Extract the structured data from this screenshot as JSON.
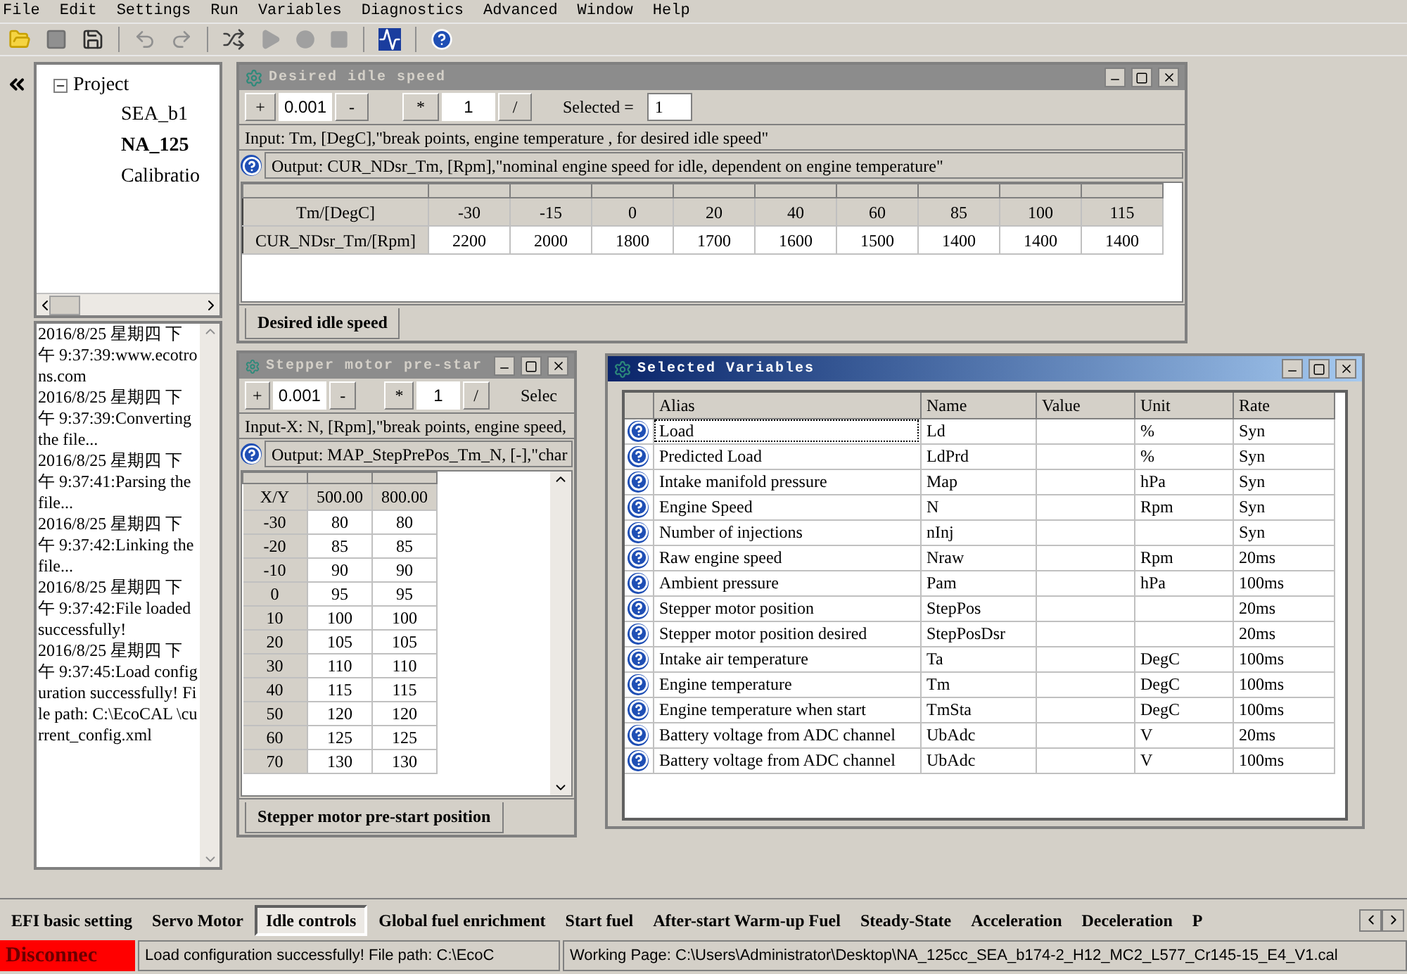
{
  "menu": [
    "File",
    "Edit",
    "Settings",
    "Run",
    "Variables",
    "Diagnostics",
    "Advanced",
    "Window",
    "Help"
  ],
  "tree": {
    "label": "Project",
    "expanded": true,
    "children": [
      {
        "label": "SEA_b1",
        "selected": false
      },
      {
        "label": "NA_125",
        "selected": true
      },
      {
        "label": "Calibratio",
        "selected": false
      }
    ]
  },
  "log": [
    "2016/8/25 星期四 下午 9:37:39:www.ecotrons.com",
    "2016/8/25 星期四 下午 9:37:39:Converting the file...",
    "2016/8/25 星期四 下午 9:37:41:Parsing the file...",
    "2016/8/25 星期四 下午 9:37:42:Linking the file...",
    "2016/8/25 星期四 下午 9:37:42:File loaded successfully!",
    "2016/8/25 星期四 下午 9:37:45:Load configuration successfully! File path: C:\\EcoCAL \\current_config.xml"
  ],
  "idle_window": {
    "title": "Desired idle speed",
    "active": false,
    "toolbar": {
      "add": "+",
      "step": "0.001",
      "sub": "-",
      "mul": "*",
      "factor": "1",
      "div": "/",
      "selected_label": "Selected =",
      "selected_value": "1"
    },
    "input": "Input: Tm, [DegC],\"break points, engine temperature , for desired idle speed\"",
    "output": "Output: CUR_NDsr_Tm, [Rpm],\"nominal engine speed for idle, dependent on engine temperature\"",
    "rows": [
      [
        "Tm/[DegC]",
        "-30",
        "-15",
        "0",
        "20",
        "40",
        "60",
        "85",
        "100",
        "115"
      ],
      [
        "CUR_NDsr_Tm/[Rpm]",
        "2200",
        "2000",
        "1800",
        "1700",
        "1600",
        "1500",
        "1400",
        "1400",
        "1400"
      ]
    ],
    "tab": "Desired idle speed"
  },
  "stepper_window": {
    "title": "Stepper motor pre-star",
    "active": false,
    "toolbar": {
      "add": "+",
      "step": "0.001",
      "sub": "-",
      "mul": "*",
      "factor": "1",
      "div": "/",
      "selected_label": "Selec"
    },
    "input": "Input-X: N, [Rpm],\"break points, engine speed,",
    "output": "Output: MAP_StepPrePos_Tm_N, [-],\"char",
    "header": [
      "X/Y",
      "500.00",
      "800.00"
    ],
    "rows": [
      [
        "-30",
        "80",
        "80"
      ],
      [
        "-20",
        "85",
        "85"
      ],
      [
        "-10",
        "90",
        "90"
      ],
      [
        "0",
        "95",
        "95"
      ],
      [
        "10",
        "100",
        "100"
      ],
      [
        "20",
        "105",
        "105"
      ],
      [
        "30",
        "110",
        "110"
      ],
      [
        "40",
        "115",
        "115"
      ],
      [
        "50",
        "120",
        "120"
      ],
      [
        "60",
        "125",
        "125"
      ],
      [
        "70",
        "130",
        "130"
      ]
    ],
    "tab": "Stepper motor pre-start position"
  },
  "variables_window": {
    "title": "Selected Variables",
    "active": true,
    "columns": [
      "Alias",
      "Name",
      "Value",
      "Unit",
      "Rate"
    ],
    "rows": [
      {
        "alias": "Load",
        "name": "Ld",
        "unit": "%",
        "rate": "Syn",
        "selected": true
      },
      {
        "alias": "Predicted Load",
        "name": "LdPrd",
        "unit": "%",
        "rate": "Syn",
        "selected": false
      },
      {
        "alias": "Intake manifold pressure",
        "name": "Map",
        "unit": "hPa",
        "rate": "Syn",
        "selected": false
      },
      {
        "alias": "Engine Speed",
        "name": "N",
        "unit": "Rpm",
        "rate": "Syn",
        "selected": false
      },
      {
        "alias": "Number of injections",
        "name": "nInj",
        "unit": "",
        "rate": "Syn",
        "selected": false
      },
      {
        "alias": "Raw engine speed",
        "name": "Nraw",
        "unit": "Rpm",
        "rate": "20ms",
        "selected": false
      },
      {
        "alias": "Ambient pressure",
        "name": "Pam",
        "unit": "hPa",
        "rate": "100ms",
        "selected": false
      },
      {
        "alias": "Stepper motor position",
        "name": "StepPos",
        "unit": "",
        "rate": "20ms",
        "selected": false
      },
      {
        "alias": "Stepper motor position desired",
        "name": "StepPosDsr",
        "unit": "",
        "rate": "20ms",
        "selected": false
      },
      {
        "alias": "Intake air temperature",
        "name": "Ta",
        "unit": "DegC",
        "rate": "100ms",
        "selected": false
      },
      {
        "alias": "Engine temperature",
        "name": "Tm",
        "unit": "DegC",
        "rate": "100ms",
        "selected": false
      },
      {
        "alias": "Engine temperature when start",
        "name": "TmSta",
        "unit": "DegC",
        "rate": "100ms",
        "selected": false
      },
      {
        "alias": "Battery voltage from ADC channel",
        "name": "UbAdc",
        "unit": "V",
        "rate": "20ms",
        "selected": false
      },
      {
        "alias": "Battery voltage from ADC channel",
        "name": "UbAdc",
        "unit": "V",
        "rate": "100ms",
        "selected": false
      }
    ]
  },
  "bottom_tabs": [
    {
      "label": "EFI basic setting",
      "selected": false
    },
    {
      "label": "Servo Motor",
      "selected": false
    },
    {
      "label": "Idle controls",
      "selected": true
    },
    {
      "label": "Global fuel enrichment",
      "selected": false
    },
    {
      "label": "Start fuel",
      "selected": false
    },
    {
      "label": "After-start Warm-up Fuel",
      "selected": false
    },
    {
      "label": "Steady-State",
      "selected": false
    },
    {
      "label": "Acceleration",
      "selected": false
    },
    {
      "label": "Deceleration",
      "selected": false
    },
    {
      "label": "P",
      "selected": false
    }
  ],
  "status_bar": {
    "connection": "Disconnec",
    "message": "Load configuration successfully! File path: C:\\EcoC",
    "working_page": "Working Page:  C:\\Users\\Administrator\\Desktop\\NA_125cc_SEA_b174-2_H12_MC2_L577_Cr145-15_E4_V1.cal"
  }
}
